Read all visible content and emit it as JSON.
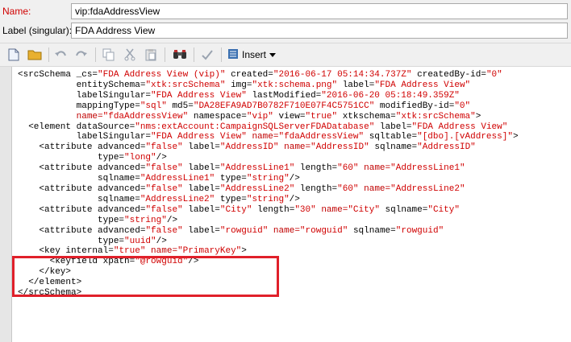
{
  "form": {
    "name_label": "Name:",
    "name_value": "vip:fdaAddressView",
    "label_label": "Label (singular):",
    "label_value": "FDA Address View"
  },
  "toolbar": {
    "insert_label": "Insert",
    "icons": [
      "new-doc-icon",
      "folder-icon",
      "undo-icon",
      "redo-icon",
      "copy-icon",
      "cut-icon",
      "paste-icon",
      "find-icon",
      "check-icon",
      "insert-icon",
      "dropdown-icon"
    ]
  },
  "code": {
    "lines": [
      [
        [
          "k",
          "<srcSchema "
        ],
        [
          "a",
          "_cs="
        ],
        [
          "v",
          "\"FDA Address View (vip)\""
        ],
        [
          "a",
          " created="
        ],
        [
          "v",
          "\"2016-06-17 05:14:34.737Z\""
        ],
        [
          "a",
          " createdBy-id="
        ],
        [
          "v",
          "\"0\""
        ]
      ],
      [
        [
          "a",
          "           entitySchema="
        ],
        [
          "v",
          "\"xtk:srcSchema\""
        ],
        [
          "a",
          " img="
        ],
        [
          "v",
          "\"xtk:schema.png\""
        ],
        [
          "a",
          " label="
        ],
        [
          "v",
          "\"FDA Address View\""
        ]
      ],
      [
        [
          "a",
          "           labelSingular="
        ],
        [
          "v",
          "\"FDA Address View\""
        ],
        [
          "a",
          " lastModified="
        ],
        [
          "v",
          "\"2016-06-20 05:18:49.359Z\""
        ]
      ],
      [
        [
          "a",
          "           mappingType="
        ],
        [
          "v",
          "\"sql\""
        ],
        [
          "a",
          " md5="
        ],
        [
          "v",
          "\"DA28EFA9AD7B0782F710E07F4C5751CC\""
        ],
        [
          "a",
          " modifiedBy-id="
        ],
        [
          "v",
          "\"0\""
        ]
      ],
      [
        [
          "n",
          "           name="
        ],
        [
          "v",
          "\"fdaAddressView\""
        ],
        [
          "a",
          " namespace="
        ],
        [
          "v",
          "\"vip\""
        ],
        [
          "a",
          " view="
        ],
        [
          "v",
          "\"true\""
        ],
        [
          "a",
          " xtkschema="
        ],
        [
          "v",
          "\"xtk:srcSchema\""
        ],
        [
          "k",
          ">"
        ]
      ],
      [
        [
          "k",
          "  <element "
        ],
        [
          "a",
          "dataSource="
        ],
        [
          "v",
          "\"nms:extAccount:CampaignSQLServerFDADatabase\""
        ],
        [
          "a",
          " label="
        ],
        [
          "v",
          "\"FDA Address View\""
        ]
      ],
      [
        [
          "a",
          "           labelSingular="
        ],
        [
          "v",
          "\"FDA Address View\""
        ],
        [
          "n",
          " name="
        ],
        [
          "v",
          "\"fdaAddressView\""
        ],
        [
          "a",
          " sqltable="
        ],
        [
          "v",
          "\"[dbo].[vAddress]\""
        ],
        [
          "k",
          ">"
        ]
      ],
      [
        [
          "k",
          "    <attribute "
        ],
        [
          "a",
          "advanced="
        ],
        [
          "v",
          "\"false\""
        ],
        [
          "a",
          " label="
        ],
        [
          "v",
          "\"AddressID\""
        ],
        [
          "n",
          " name="
        ],
        [
          "v",
          "\"AddressID\""
        ],
        [
          "a",
          " sqlname="
        ],
        [
          "v",
          "\"AddressID\""
        ]
      ],
      [
        [
          "a",
          "               type="
        ],
        [
          "v",
          "\"long\""
        ],
        [
          "k",
          "/>"
        ]
      ],
      [
        [
          "k",
          "    <attribute "
        ],
        [
          "a",
          "advanced="
        ],
        [
          "v",
          "\"false\""
        ],
        [
          "a",
          " label="
        ],
        [
          "v",
          "\"AddressLine1\""
        ],
        [
          "a",
          " length="
        ],
        [
          "v",
          "\"60\""
        ],
        [
          "n",
          " name="
        ],
        [
          "v",
          "\"AddressLine1\""
        ]
      ],
      [
        [
          "a",
          "               sqlname="
        ],
        [
          "v",
          "\"AddressLine1\""
        ],
        [
          "a",
          " type="
        ],
        [
          "v",
          "\"string\""
        ],
        [
          "k",
          "/>"
        ]
      ],
      [
        [
          "k",
          "    <attribute "
        ],
        [
          "a",
          "advanced="
        ],
        [
          "v",
          "\"false\""
        ],
        [
          "a",
          " label="
        ],
        [
          "v",
          "\"AddressLine2\""
        ],
        [
          "a",
          " length="
        ],
        [
          "v",
          "\"60\""
        ],
        [
          "n",
          " name="
        ],
        [
          "v",
          "\"AddressLine2\""
        ]
      ],
      [
        [
          "a",
          "               sqlname="
        ],
        [
          "v",
          "\"AddressLine2\""
        ],
        [
          "a",
          " type="
        ],
        [
          "v",
          "\"string\""
        ],
        [
          "k",
          "/>"
        ]
      ],
      [
        [
          "k",
          "    <attribute "
        ],
        [
          "a",
          "advanced="
        ],
        [
          "v",
          "\"false\""
        ],
        [
          "a",
          " label="
        ],
        [
          "v",
          "\"City\""
        ],
        [
          "a",
          " length="
        ],
        [
          "v",
          "\"30\""
        ],
        [
          "n",
          " name="
        ],
        [
          "v",
          "\"City\""
        ],
        [
          "a",
          " sqlname="
        ],
        [
          "v",
          "\"City\""
        ]
      ],
      [
        [
          "a",
          "               type="
        ],
        [
          "v",
          "\"string\""
        ],
        [
          "k",
          "/>"
        ]
      ],
      [
        [
          "k",
          "    <attribute "
        ],
        [
          "a",
          "advanced="
        ],
        [
          "v",
          "\"false\""
        ],
        [
          "a",
          " label="
        ],
        [
          "v",
          "\"rowguid\""
        ],
        [
          "n",
          " name="
        ],
        [
          "v",
          "\"rowguid\""
        ],
        [
          "a",
          " sqlname="
        ],
        [
          "v",
          "\"rowguid\""
        ]
      ],
      [
        [
          "a",
          "               type="
        ],
        [
          "v",
          "\"uuid\""
        ],
        [
          "k",
          "/>"
        ]
      ],
      [
        [
          "k",
          "    <key "
        ],
        [
          "a",
          "internal="
        ],
        [
          "v",
          "\"true\""
        ],
        [
          "n",
          " name="
        ],
        [
          "v",
          "\"PrimaryKey\""
        ],
        [
          "k",
          ">"
        ]
      ],
      [
        [
          "k",
          "      <keyfield "
        ],
        [
          "a",
          "xpath="
        ],
        [
          "v",
          "\"@rowguid\""
        ],
        [
          "k",
          "/>"
        ]
      ],
      [
        [
          "k",
          "    </key>"
        ]
      ],
      [
        [
          "k",
          "  </element>"
        ]
      ],
      [
        [
          "k",
          "</srcSchema>"
        ]
      ]
    ]
  },
  "colors": {
    "highlight": "#e0202a",
    "attr_value": "#d00000",
    "name_label": "#d00000"
  }
}
